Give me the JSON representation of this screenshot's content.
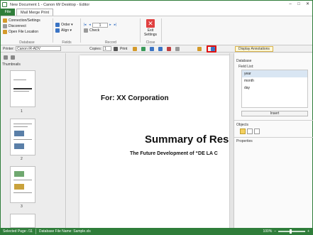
{
  "window": {
    "title": "New Document 1 - Canon iW Desktop - Editor",
    "controls": [
      "–",
      "□",
      "✕"
    ]
  },
  "ribbon": {
    "file_tab": "File",
    "active_tab": "Mail Merge Print",
    "database_group": {
      "label": "Database",
      "items": [
        "Connection/Settings",
        "Disconnect",
        "Open File Location"
      ]
    },
    "fields_group": {
      "label": "Fields",
      "order": "Order",
      "align": "Align"
    },
    "record_group": {
      "label": "Record",
      "value": "1",
      "check": "Check"
    },
    "close_group": {
      "label": "Close",
      "exit_label_1": "Exit",
      "exit_label_2": "Settings"
    }
  },
  "toolbar": {
    "printer_label": "Printer:",
    "printer_value": "Canon iR-ADV",
    "copies_label": "Copies:",
    "copies_value": "1",
    "print_label": "Print",
    "display_annotations": "Display Annotations"
  },
  "left_panel": {
    "title": "Thumbnails",
    "pages": [
      "1",
      "2",
      "3"
    ]
  },
  "document": {
    "for_line": "For: XX Corporation",
    "summary": "Summary of Rese",
    "future": "The Future Development of “DE LA C"
  },
  "right_panel": {
    "database_title": "Database",
    "field_list_label": "Field List:",
    "fields": [
      "year",
      "month",
      "day"
    ],
    "insert": "Insert",
    "objects_title": "Objects",
    "properties_title": "Properties"
  },
  "status": {
    "selected_page": "Selected Page: /11",
    "db_file": "Database File Name: Sample.xls",
    "zoom": "100%"
  },
  "colors": {
    "accent": "#2f7d3a",
    "highlight": "#e01010"
  }
}
